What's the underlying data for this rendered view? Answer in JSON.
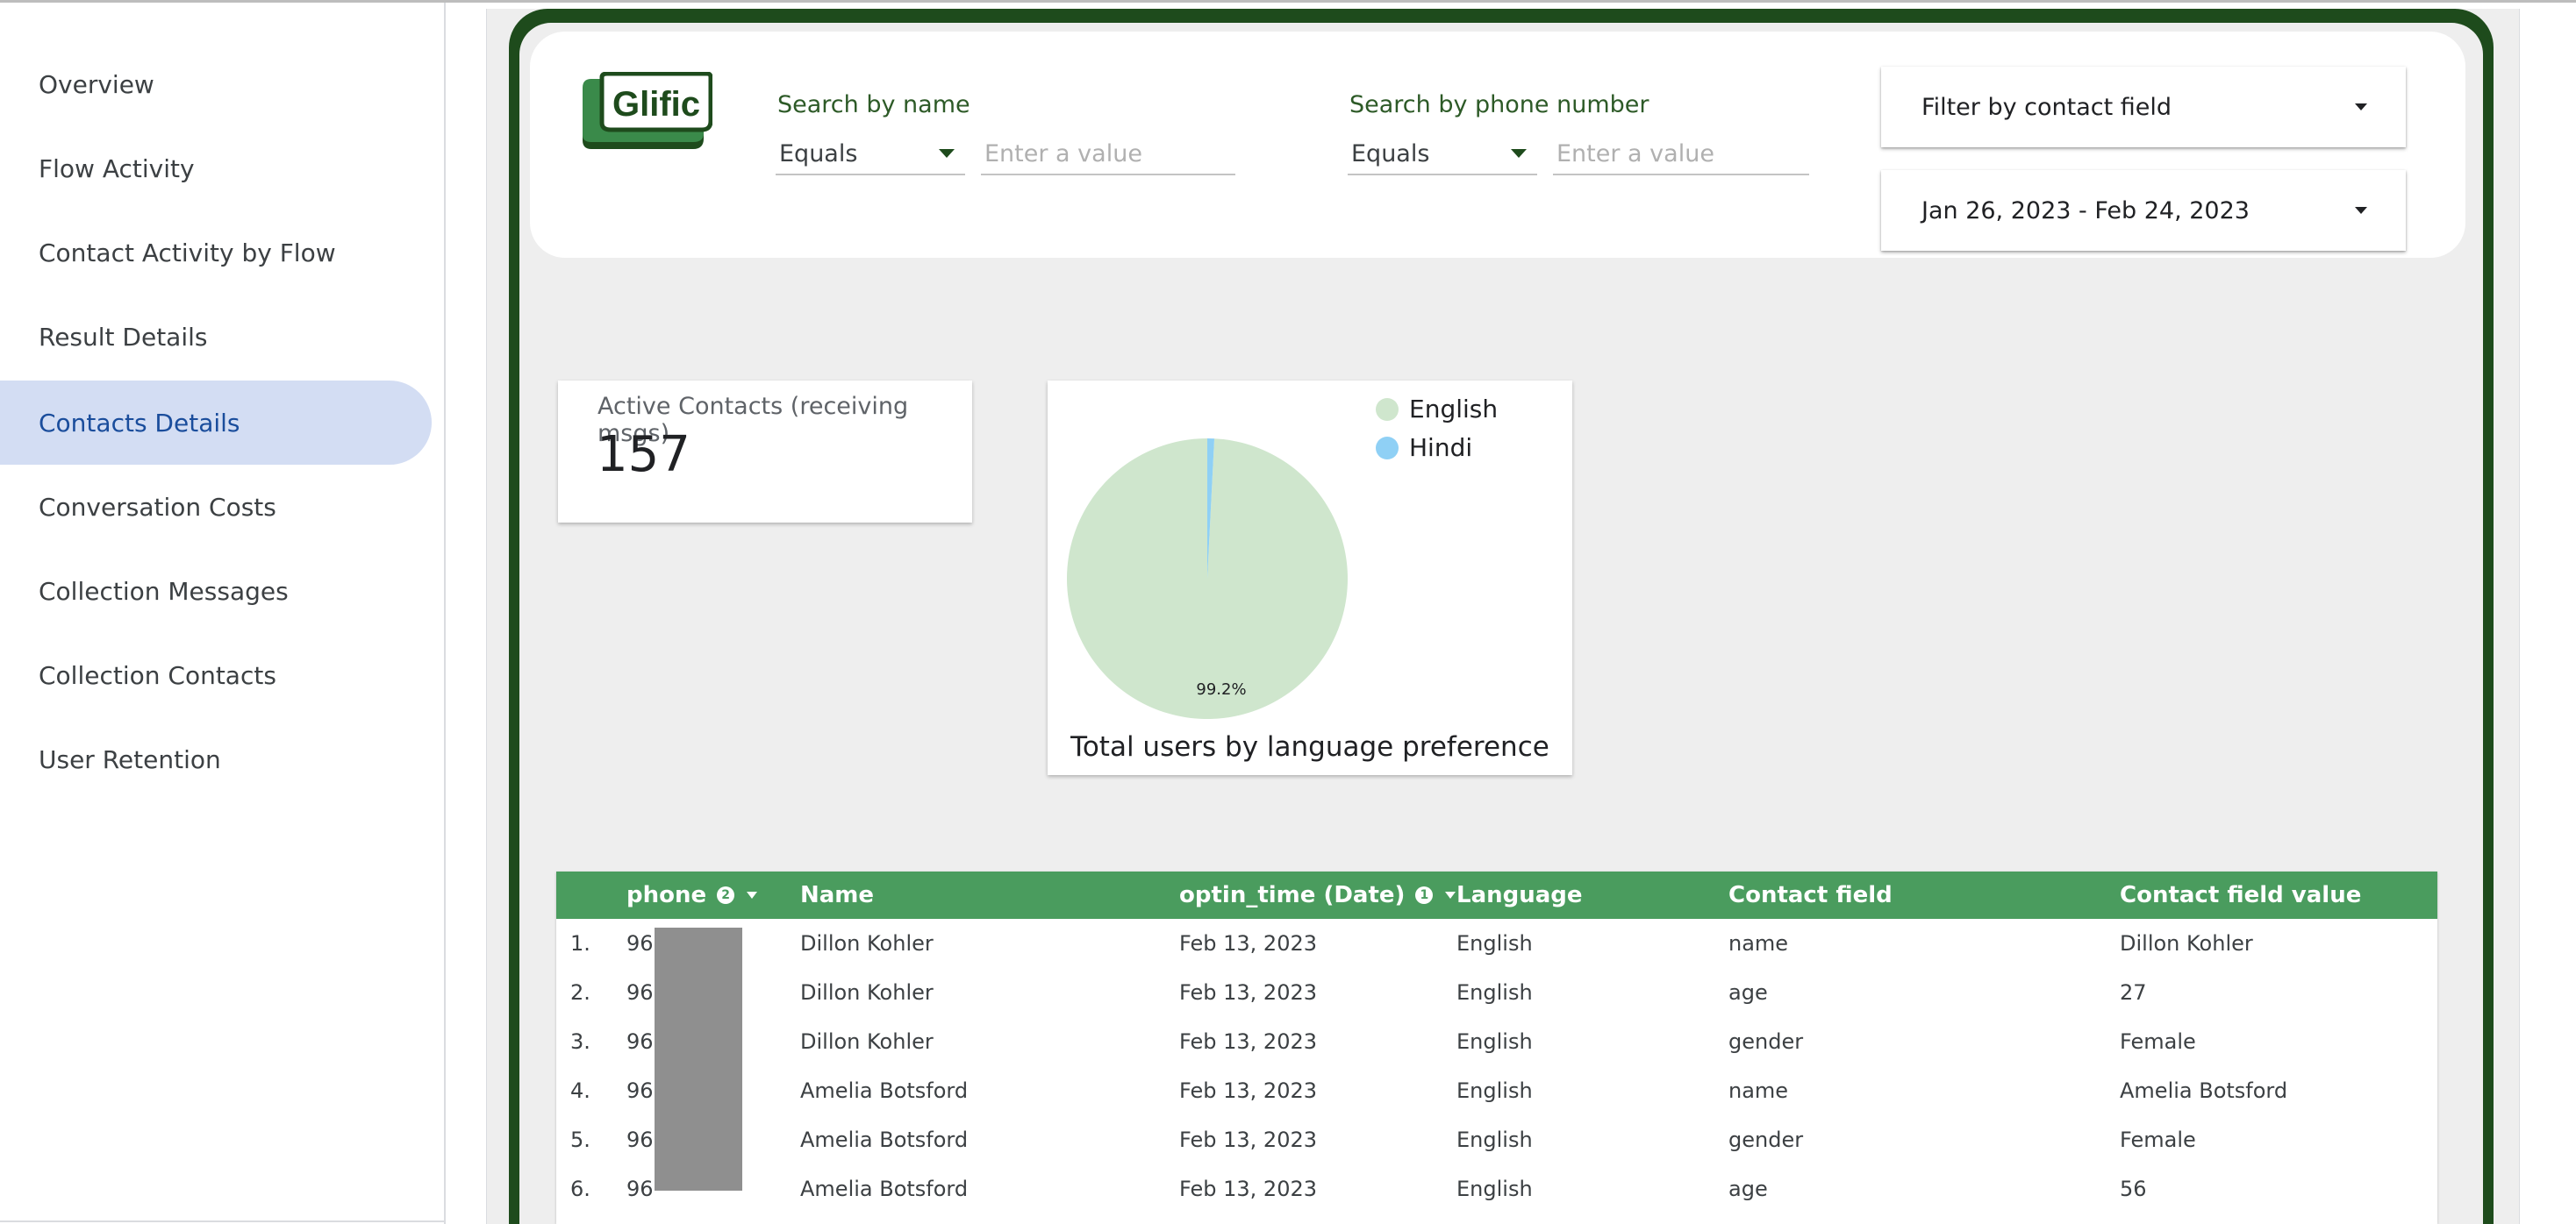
{
  "sidebar": {
    "items": [
      {
        "label": "Overview",
        "active": false
      },
      {
        "label": "Flow Activity",
        "active": false
      },
      {
        "label": "Contact Activity by Flow",
        "active": false
      },
      {
        "label": "Result Details",
        "active": false
      },
      {
        "label": "Contacts Details",
        "active": true
      },
      {
        "label": "Conversation Costs",
        "active": false
      },
      {
        "label": "Collection Messages",
        "active": false
      },
      {
        "label": "Collection Contacts",
        "active": false
      },
      {
        "label": "User Retention",
        "active": false
      }
    ]
  },
  "header": {
    "logo_text": "Glific",
    "search_name": {
      "label": "Search by name",
      "operator": "Equals",
      "placeholder": "Enter a value"
    },
    "search_phone": {
      "label": "Search by phone number",
      "operator": "Equals",
      "placeholder": "Enter a value"
    },
    "filter_contact_field": "Filter by contact field",
    "date_range": "Jan 26, 2023 - Feb 24, 2023"
  },
  "scorecard": {
    "label": "Active Contacts (receiving msgs)",
    "value": "157"
  },
  "chart_data": {
    "type": "pie",
    "title": "Total users by language preference",
    "slices": [
      {
        "label": "English",
        "value": 99.2,
        "color": "#cfe6cd"
      },
      {
        "label": "Hindi",
        "value": 0.8,
        "color": "#8fd0f5"
      }
    ],
    "data_labels": [
      "99.2%"
    ],
    "legend_position": "top-right"
  },
  "table": {
    "columns": [
      {
        "label": "phone",
        "info": "2",
        "sort": true
      },
      {
        "label": "Name",
        "info": "",
        "sort": false
      },
      {
        "label": "optin_time (Date)",
        "info": "1",
        "sort": true
      },
      {
        "label": "Language",
        "info": "",
        "sort": false
      },
      {
        "label": "Contact field",
        "info": "",
        "sort": false
      },
      {
        "label": "Contact field value",
        "info": "",
        "sort": false
      }
    ],
    "rows": [
      {
        "index": "1.",
        "phone": "96",
        "name": "Dillon Kohler",
        "optin": "Feb 13, 2023",
        "language": "English",
        "field": "name",
        "value": "Dillon Kohler"
      },
      {
        "index": "2.",
        "phone": "96",
        "name": "Dillon Kohler",
        "optin": "Feb 13, 2023",
        "language": "English",
        "field": "age",
        "value": "27"
      },
      {
        "index": "3.",
        "phone": "96",
        "name": "Dillon Kohler",
        "optin": "Feb 13, 2023",
        "language": "English",
        "field": "gender",
        "value": "Female"
      },
      {
        "index": "4.",
        "phone": "96",
        "name": "Amelia Botsford",
        "optin": "Feb 13, 2023",
        "language": "English",
        "field": "name",
        "value": "Amelia Botsford"
      },
      {
        "index": "5.",
        "phone": "96",
        "name": "Amelia Botsford",
        "optin": "Feb 13, 2023",
        "language": "English",
        "field": "gender",
        "value": "Female"
      },
      {
        "index": "6.",
        "phone": "96",
        "name": "Amelia Botsford",
        "optin": "Feb 13, 2023",
        "language": "English",
        "field": "age",
        "value": "56"
      }
    ]
  }
}
